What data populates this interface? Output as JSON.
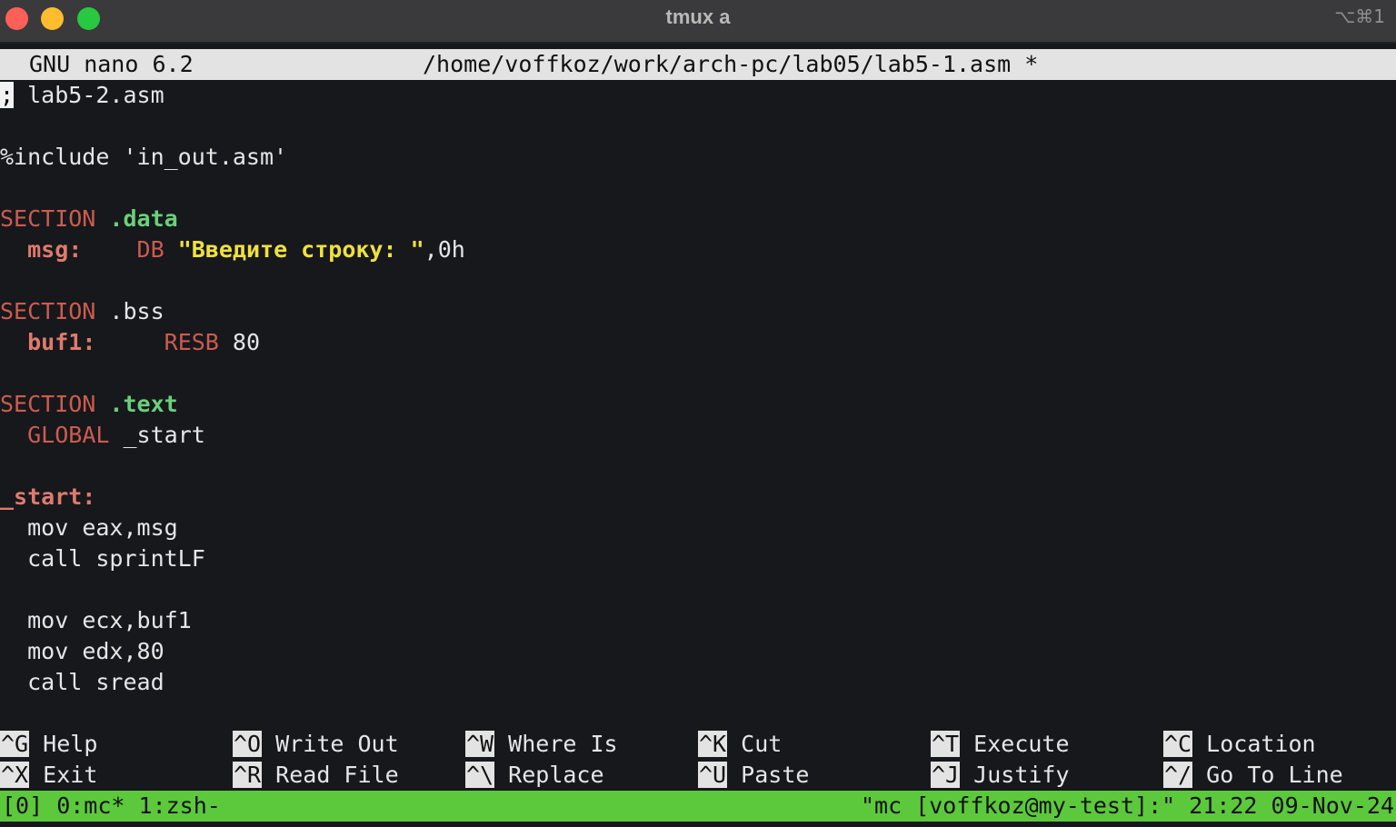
{
  "window": {
    "title": "tmux a",
    "shortcut": "⌥⌘1"
  },
  "nano": {
    "app": "GNU nano 6.2",
    "filepath": "/home/voffkoz/work/arch-pc/lab05/lab5-1.asm *"
  },
  "code": {
    "cursor_char": ";",
    "l1": " lab5-2.asm",
    "l3": "%include 'in_out.asm'",
    "l5_kw": "SECTION",
    "l5_sec": ".data",
    "l6_lbl": "msg:",
    "l6_kw": "DB",
    "l6_str": "\"Введите строку: \"",
    "l6_rest": ",0h",
    "l8_kw": "SECTION",
    "l8_rest": ".bss",
    "l9_lbl": "buf1:",
    "l9_kw": "RESB",
    "l9_rest": "80",
    "l11_kw": "SECTION",
    "l11_sec": ".text",
    "l12_kw": "GLOBAL",
    "l12_rest": "_start",
    "l14_lbl": "_start:",
    "l15": "mov eax,msg",
    "l16": "call sprintLF",
    "l18": "mov ecx,buf1",
    "l19": "mov edx,80",
    "l20": "call sread"
  },
  "shortcuts": [
    {
      "key": "^G",
      "label": "Help"
    },
    {
      "key": "^O",
      "label": "Write Out"
    },
    {
      "key": "^W",
      "label": "Where Is"
    },
    {
      "key": "^K",
      "label": "Cut"
    },
    {
      "key": "^T",
      "label": "Execute"
    },
    {
      "key": "^C",
      "label": "Location"
    },
    {
      "key": "^X",
      "label": "Exit"
    },
    {
      "key": "^R",
      "label": "Read File"
    },
    {
      "key": "^\\",
      "label": "Replace"
    },
    {
      "key": "^U",
      "label": "Paste"
    },
    {
      "key": "^J",
      "label": "Justify"
    },
    {
      "key": "^/",
      "label": "Go To Line"
    }
  ],
  "tmux": {
    "left": "[0] 0:mc* 1:zsh-",
    "right": "\"mc [voffkoz@my-test]:\" 21:22 09-Nov-24"
  },
  "colors": {
    "titlebar": "#3a3a3c",
    "terminal_bg": "#16181c",
    "keyword": "#cd5c4e",
    "section": "#6ad07a",
    "label": "#e07a6e",
    "string": "#f0e040",
    "status_bar": "#5cc83c"
  }
}
